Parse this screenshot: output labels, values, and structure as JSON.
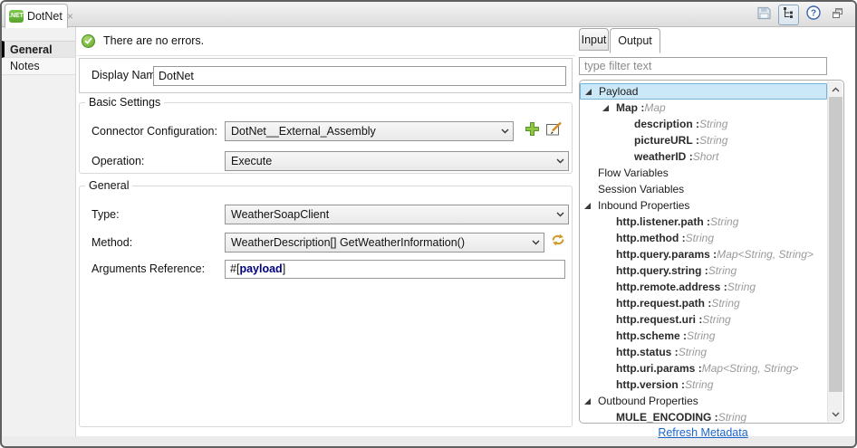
{
  "window": {
    "tab": {
      "icon_label": ".NET",
      "title": "DotNet",
      "close_glyph": "×"
    }
  },
  "sidebar": {
    "items": [
      {
        "label": "General",
        "selected": true
      },
      {
        "label": "Notes",
        "selected": false
      }
    ]
  },
  "main": {
    "status_message": "There are no errors.",
    "display_name": {
      "label": "Display Name:",
      "value": "DotNet"
    },
    "basic_settings": {
      "legend": "Basic Settings",
      "connector_configuration": {
        "label": "Connector Configuration:",
        "value": "DotNet__External_Assembly"
      },
      "operation": {
        "label": "Operation:",
        "value": "Execute"
      }
    },
    "general": {
      "legend": "General",
      "type": {
        "label": "Type:",
        "value": "WeatherSoapClient"
      },
      "method": {
        "label": "Method:",
        "value": "WeatherDescription[] GetWeatherInformation()"
      },
      "arguments_reference": {
        "label": "Arguments Reference:",
        "value_prefix": "#[",
        "value_expression": "payload",
        "value_suffix": "]"
      }
    }
  },
  "metadata_panel": {
    "tabs": [
      {
        "label": "Input",
        "active": false
      },
      {
        "label": "Output",
        "active": true
      }
    ],
    "filter": {
      "placeholder": "type filter text"
    },
    "tree": [
      {
        "label": "Payload",
        "level": 0,
        "expanded": true,
        "selected": true
      },
      {
        "label": "Map",
        "type": "Map",
        "level": 1,
        "expanded": true
      },
      {
        "label": "description",
        "type": "String",
        "level": 2
      },
      {
        "label": "pictureURL",
        "type": "String",
        "level": 2
      },
      {
        "label": "weatherID",
        "type": "Short",
        "level": 2
      },
      {
        "label": "Flow Variables",
        "level": 0
      },
      {
        "label": "Session Variables",
        "level": 0
      },
      {
        "label": "Inbound Properties",
        "level": 0,
        "expanded": true
      },
      {
        "label": "http.listener.path",
        "type": "String",
        "level": 1
      },
      {
        "label": "http.method",
        "type": "String",
        "level": 1
      },
      {
        "label": "http.query.params",
        "type": "Map<String, String>",
        "level": 1
      },
      {
        "label": "http.query.string",
        "type": "String",
        "level": 1
      },
      {
        "label": "http.remote.address",
        "type": "String",
        "level": 1
      },
      {
        "label": "http.request.path",
        "type": "String",
        "level": 1
      },
      {
        "label": "http.request.uri",
        "type": "String",
        "level": 1
      },
      {
        "label": "http.scheme",
        "type": "String",
        "level": 1
      },
      {
        "label": "http.status",
        "type": "String",
        "level": 1
      },
      {
        "label": "http.uri.params",
        "type": "Map<String, String>",
        "level": 1
      },
      {
        "label": "http.version",
        "type": "String",
        "level": 1
      },
      {
        "label": "Outbound Properties",
        "level": 0,
        "expanded": true
      },
      {
        "label": "MULE_ENCODING",
        "type": "String",
        "level": 1
      }
    ],
    "refresh_link": "Refresh Metadata"
  },
  "colors": {
    "dotnet_green": "#6cbf3f",
    "status_green": "#61a62a",
    "selection_fill": "#cbe8f8",
    "selection_border": "#74b2d8",
    "link_blue": "#1a66cc",
    "expression_blue": "#000080",
    "type_gray": "#9a9a9a",
    "accent_orange": "#cf9b2a"
  }
}
